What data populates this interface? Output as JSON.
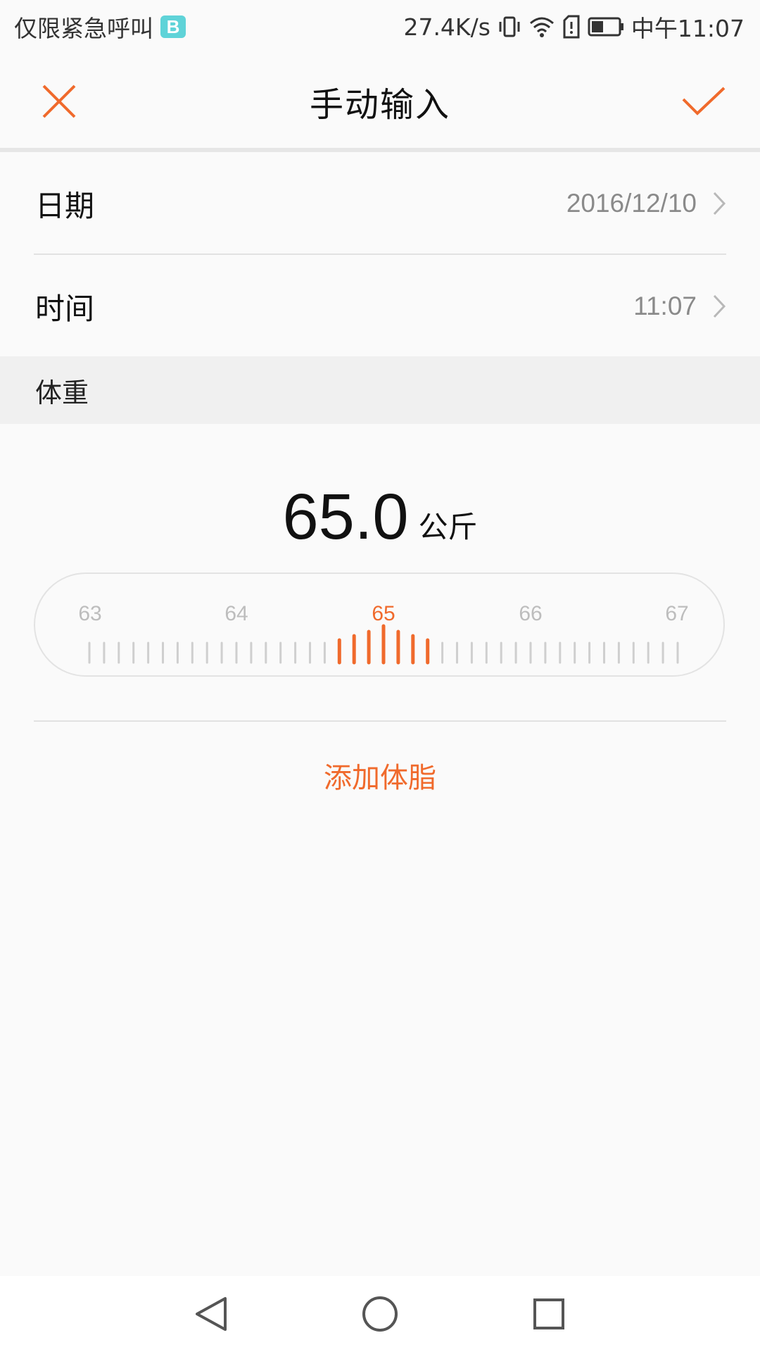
{
  "status_bar": {
    "carrier_text": "仅限紧急呼叫",
    "app_badge": "B",
    "net_speed": "27.4K/s",
    "time": "中午11:07",
    "icons": [
      "vibrate-icon",
      "wifi-icon",
      "sim-alert-icon",
      "battery-icon"
    ]
  },
  "app_bar": {
    "title": "手动输入",
    "close_icon": "close-icon",
    "confirm_icon": "check-icon",
    "accent_color": "#f06a2c"
  },
  "form": {
    "date_label": "日期",
    "date_value": "2016/12/10",
    "time_label": "时间",
    "time_value": "11:07"
  },
  "weight": {
    "section_title": "体重",
    "value": "65.0",
    "unit": "公斤",
    "ruler_labels": [
      "63",
      "64",
      "65",
      "66",
      "67"
    ],
    "ruler_selected": "65"
  },
  "actions": {
    "add_body_fat": "添加体脂"
  },
  "nav_bar": {
    "icons": [
      "back-icon",
      "home-icon",
      "recents-icon"
    ]
  }
}
